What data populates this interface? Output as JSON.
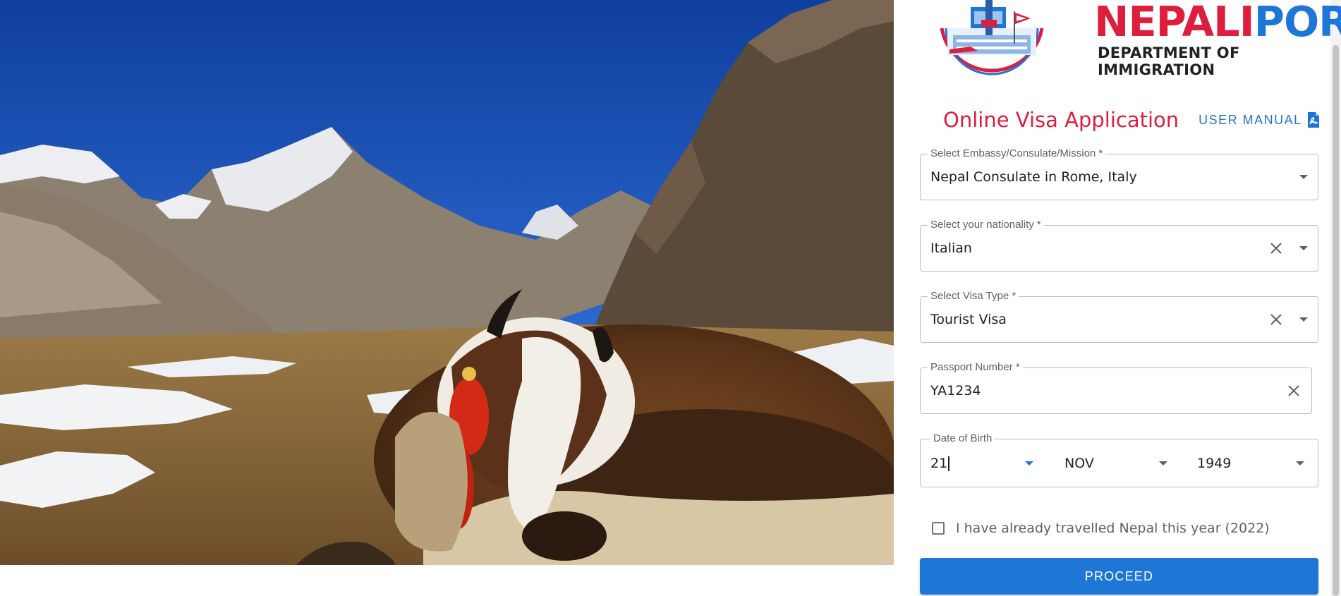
{
  "brand": {
    "name_part1": "NEPALI",
    "name_part2": "PORT",
    "department": "DEPARTMENT OF IMMIGRATION"
  },
  "page": {
    "title": "Online Visa Application",
    "user_manual_label": "USER MANUAL"
  },
  "form": {
    "embassy": {
      "label": "Select Embassy/Consulate/Mission *",
      "value": "Nepal Consulate in Rome, Italy"
    },
    "nationality": {
      "label": "Select your nationality *",
      "value": "Italian"
    },
    "visa_type": {
      "label": "Select Visa Type *",
      "value": "Tourist Visa"
    },
    "passport": {
      "label": "Passport Number *",
      "value": "YA1234"
    },
    "dob": {
      "label": "Date of Birth",
      "day": "21",
      "month": "NOV",
      "year": "1949"
    },
    "travelled_checkbox": {
      "label": "I have already travelled Nepal this year (2022)",
      "checked": false
    },
    "proceed_label": "PROCEED"
  },
  "colors": {
    "brand_red": "#dd1e3d",
    "brand_blue": "#1e76d6",
    "field_border": "#bdbdbd"
  },
  "icons": [
    "pdf-icon",
    "clear-icon",
    "chevron-down-icon",
    "airport-logo-icon"
  ]
}
